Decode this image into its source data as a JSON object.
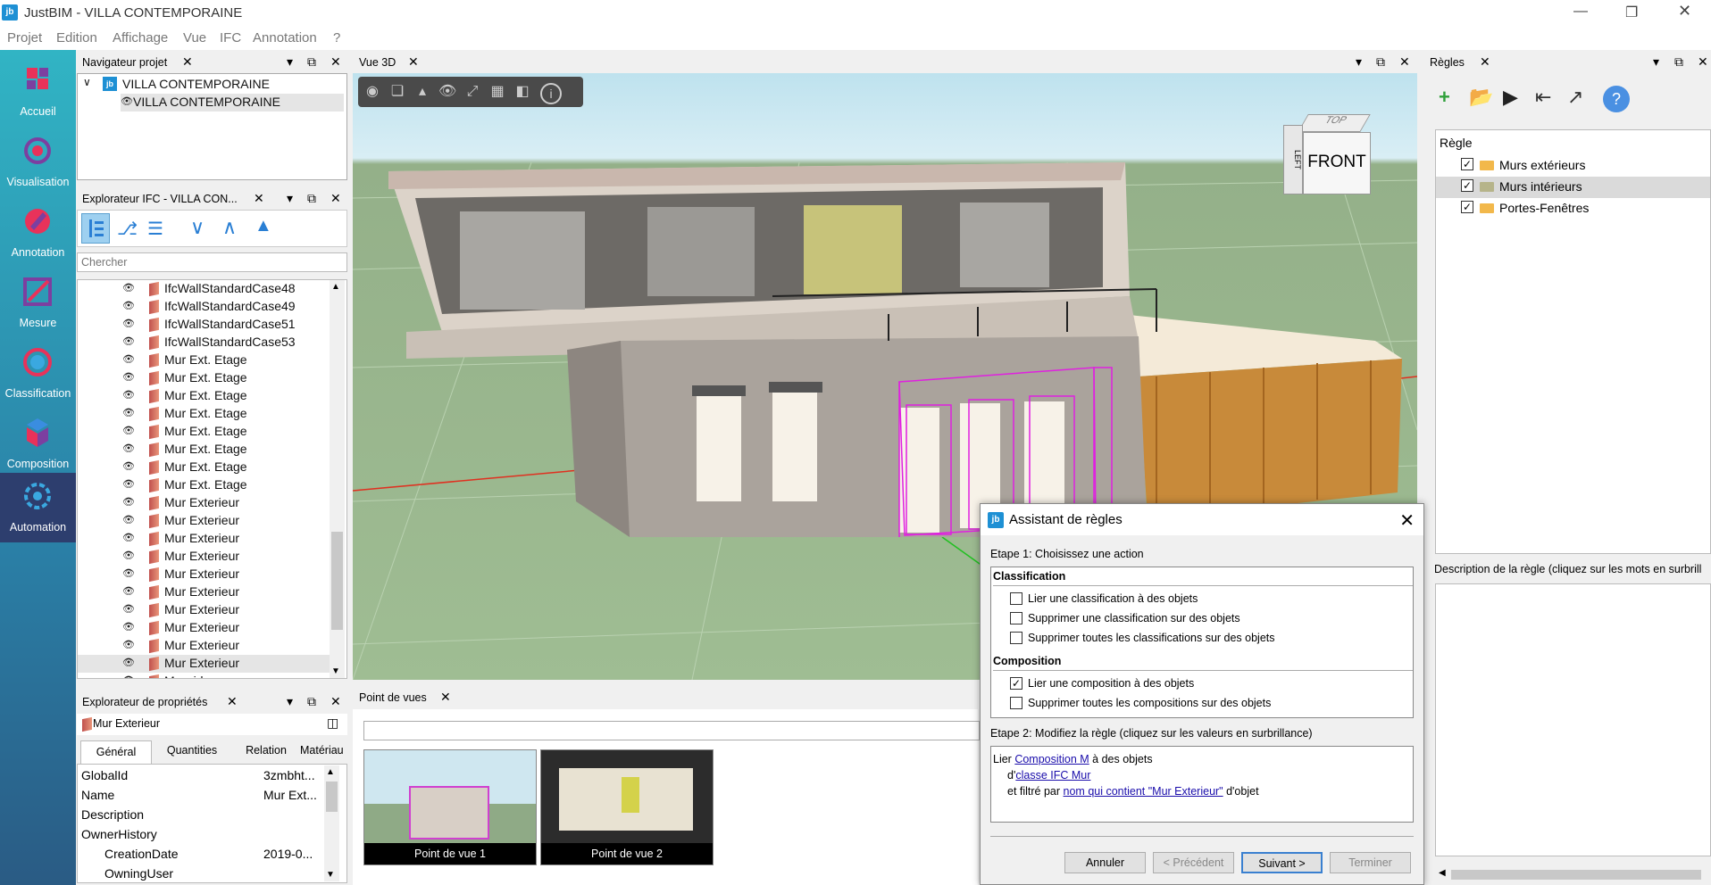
{
  "window": {
    "app_title": "JustBIM - VILLA CONTEMPORAINE",
    "app_icon": "jb"
  },
  "menu": [
    "Projet",
    "Edition",
    "Affichage",
    "Vue",
    "IFC",
    "Annotation",
    "?"
  ],
  "nav": [
    {
      "label": "Accueil",
      "icon": "home-icon"
    },
    {
      "label": "Visualisation",
      "icon": "visualisation-icon"
    },
    {
      "label": "Annotation",
      "icon": "annotation-icon"
    },
    {
      "label": "Mesure",
      "icon": "measure-icon"
    },
    {
      "label": "Classification",
      "icon": "classification-icon"
    },
    {
      "label": "Composition",
      "icon": "composition-icon"
    },
    {
      "label": "Automation",
      "icon": "automation-icon"
    }
  ],
  "project_nav": {
    "title": "Navigateur projet",
    "root": "VILLA CONTEMPORAINE",
    "child": "VILLA CONTEMPORAINE"
  },
  "ifc_explorer": {
    "title": "Explorateur IFC - VILLA CON...",
    "search_placeholder": "Chercher",
    "items": [
      "IfcWallStandardCase48",
      "IfcWallStandardCase49",
      "IfcWallStandardCase51",
      "IfcWallStandardCase53",
      "Mur Ext. Etage",
      "Mur Ext. Etage",
      "Mur Ext. Etage",
      "Mur Ext. Etage",
      "Mur Ext. Etage",
      "Mur Ext. Etage",
      "Mur Ext. Etage",
      "Mur Ext. Etage",
      "Mur Exterieur",
      "Mur Exterieur",
      "Mur Exterieur",
      "Mur Exterieur",
      "Mur Exterieur",
      "Mur Exterieur",
      "Mur Exterieur",
      "Mur Exterieur",
      "Mur Exterieur",
      "Mur Exterieur",
      "Mur rideau"
    ]
  },
  "props": {
    "title": "Explorateur de propriétés",
    "selected": "Mur Exterieur",
    "tabs": [
      "Général",
      "Quantities",
      "Relation",
      "Matériau"
    ],
    "rows": [
      {
        "k": "GlobalId",
        "v": "3zmbht..."
      },
      {
        "k": "Name",
        "v": "Mur Ext..."
      },
      {
        "k": "Description",
        "v": ""
      },
      {
        "k": "OwnerHistory",
        "v": ""
      },
      {
        "k": "CreationDate",
        "v": "2019-0..."
      },
      {
        "k": "OwningUser",
        "v": ""
      }
    ]
  },
  "view3d": {
    "title": "Vue 3D",
    "cube": {
      "top": "TOP",
      "left": "LEFT",
      "front": "FRONT"
    }
  },
  "viewpoints": {
    "title": "Point de vues",
    "items": [
      "Point de vue 1",
      "Point de vue 2"
    ]
  },
  "rules": {
    "title": "Règles",
    "tree_header": "Règle",
    "items": [
      {
        "label": "Murs extérieurs",
        "checked": true
      },
      {
        "label": "Murs intérieurs",
        "checked": true
      },
      {
        "label": "Portes-Fenêtres",
        "checked": true
      }
    ],
    "desc_label": "Description de la règle (cliquez sur les mots en surbrill"
  },
  "dialog": {
    "title": "Assistant de règles",
    "step1": "Etape 1: Choisissez une action",
    "sec1": "Classification",
    "opts1": [
      "Lier une classification à des objets",
      "Supprimer une classification sur des objets",
      "Supprimer toutes les classifications sur des objets"
    ],
    "sec2": "Composition",
    "opts2": [
      "Lier une composition à des objets",
      "Supprimer toutes les compositions sur des objets"
    ],
    "step2": "Etape 2: Modifiez la règle (cliquez sur les valeurs en surbrillance)",
    "rule": {
      "l1a": "Lier ",
      "l1link": "Composition M",
      "l1b": " à des objets",
      "l2a": "d'",
      "l2link": "classe IFC Mur",
      "l3a": "et filtré par ",
      "l3link": "nom qui contient \"Mur Exterieur\"",
      "l3b": " d'objet"
    },
    "buttons": {
      "cancel": "Annuler",
      "prev": "< Précédent",
      "next": "Suivant >",
      "finish": "Terminer"
    }
  }
}
